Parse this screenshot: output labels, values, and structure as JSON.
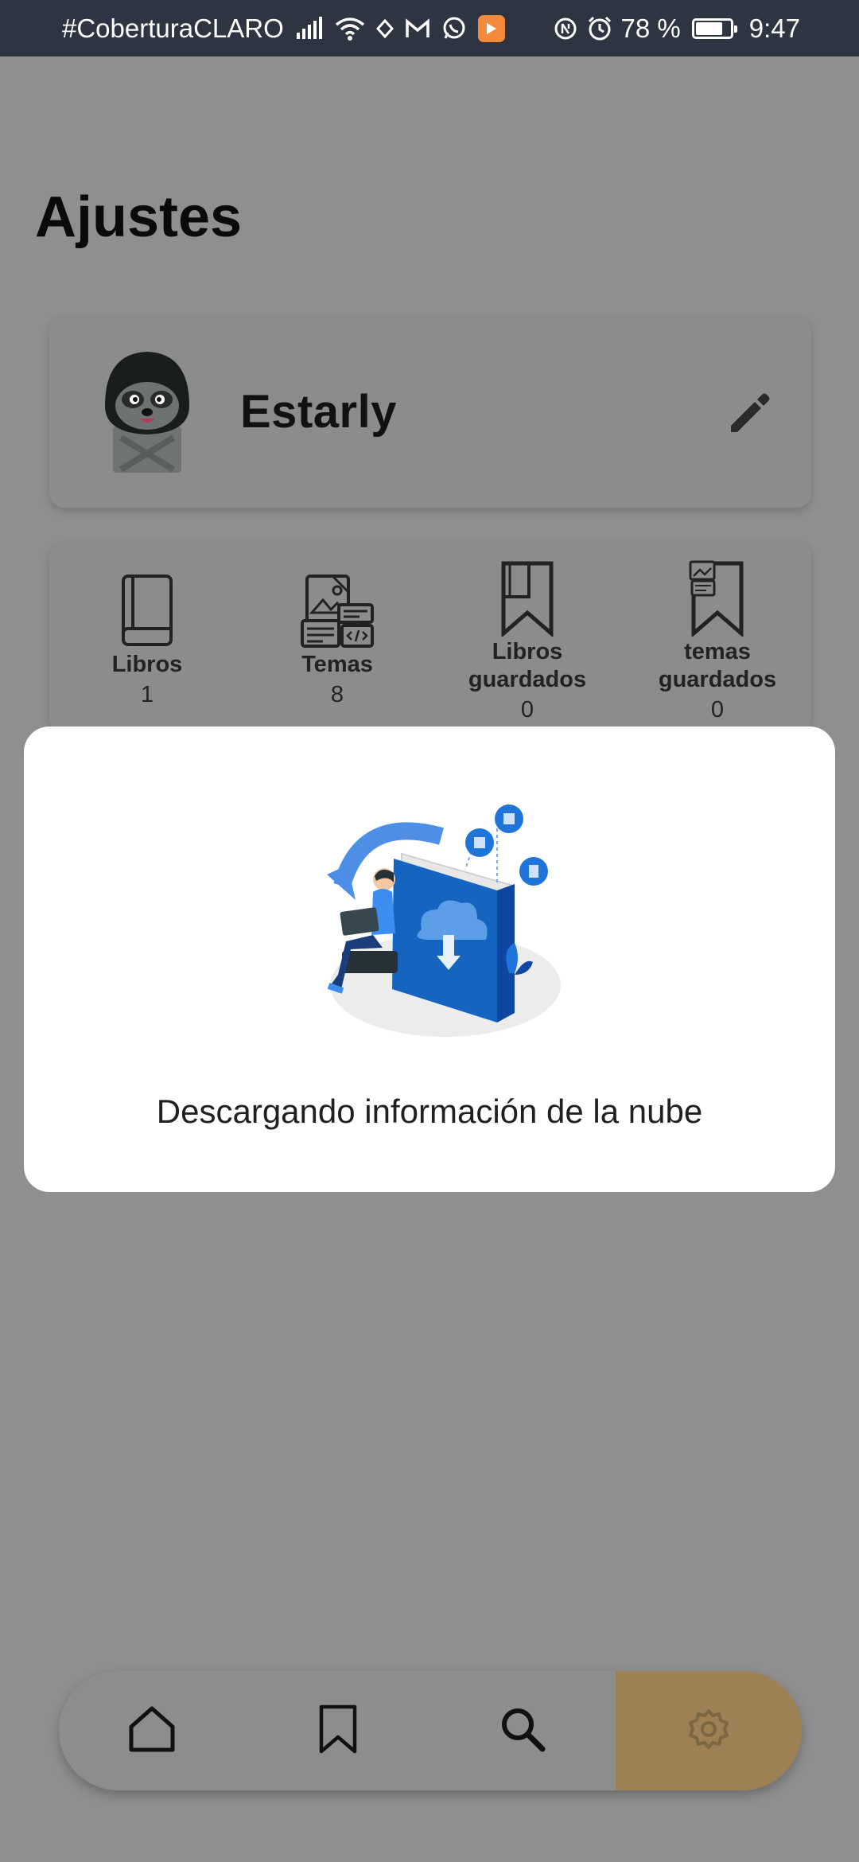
{
  "status_bar": {
    "carrier": "#CoberturaCLARO",
    "battery_percent_label": "78 %",
    "battery_level": 0.78,
    "time": "9:47",
    "icons": [
      "signal-icon",
      "wifi-icon",
      "location-icon",
      "gmail-icon",
      "whatsapp-icon",
      "app-notification-icon",
      "data-saver-icon",
      "alarm-icon",
      "battery-icon"
    ]
  },
  "page": {
    "title": "Ajustes"
  },
  "profile": {
    "name": "Estarly",
    "avatar": "raccoon-avatar",
    "edit_icon": "pencil-icon"
  },
  "stats": [
    {
      "label": "Libros",
      "count": "1",
      "icon": "book-icon"
    },
    {
      "label": "Temas",
      "count": "8",
      "icon": "topics-icon"
    },
    {
      "label": "Libros guardados",
      "count": "0",
      "icon": "saved-books-icon"
    },
    {
      "label": "temas guardados",
      "count": "0",
      "icon": "saved-topics-icon"
    }
  ],
  "modal": {
    "message": "Descargando información de la nube",
    "illustration": "cloud-download-illustration"
  },
  "bottom_nav": {
    "items": [
      {
        "icon": "home-icon",
        "active": false
      },
      {
        "icon": "bookmark-icon",
        "active": false
      },
      {
        "icon": "search-icon",
        "active": false
      },
      {
        "icon": "gear-icon",
        "active": true
      }
    ],
    "active_color": "#9d8154"
  },
  "colors": {
    "status_bar_bg": "#2e3441",
    "overlay_bg": "#8f8f8f",
    "modal_bg": "#ffffff",
    "accent": "#9d8154",
    "illustration_blue": "#1565c0"
  }
}
